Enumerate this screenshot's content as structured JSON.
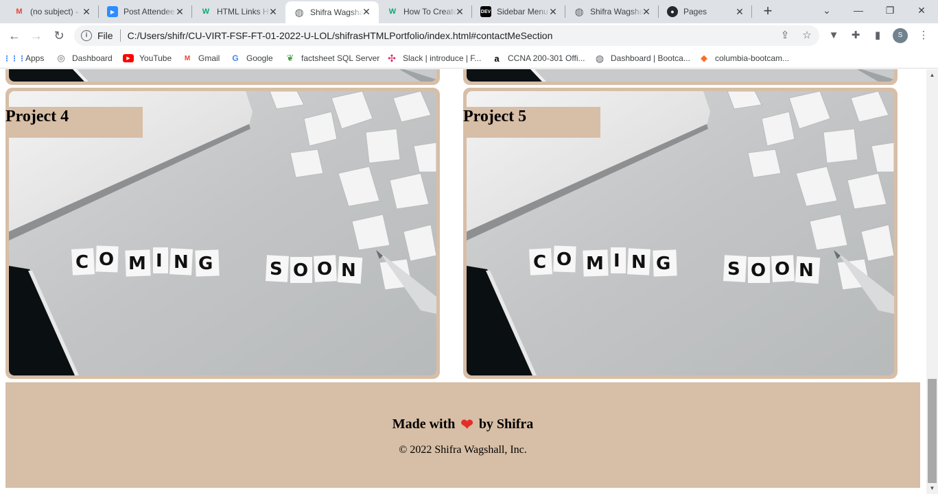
{
  "browser": {
    "tabs": [
      {
        "title": "(no subject) -",
        "favicon": "gmail-icon",
        "color": "#ea4335",
        "glyph": "M",
        "active": false
      },
      {
        "title": "Post Attendee",
        "favicon": "zoom-icon",
        "color": "#2d8cff",
        "glyph": "▶",
        "active": false
      },
      {
        "title": "HTML Links Hy",
        "favicon": "w3schools-icon",
        "color": "#04aa6d",
        "glyph": "W",
        "active": false
      },
      {
        "title": "Shifra Wagsha",
        "favicon": "globe-icon",
        "color": "#5f6368",
        "glyph": "◍",
        "active": true
      },
      {
        "title": "How To Create",
        "favicon": "w3schools-icon",
        "color": "#04aa6d",
        "glyph": "W",
        "active": false
      },
      {
        "title": "Sidebar Menu",
        "favicon": "dev-icon",
        "color": "#000000",
        "glyph": "DEV",
        "active": false
      },
      {
        "title": "Shifra Wagsha",
        "favicon": "globe-icon",
        "color": "#5f6368",
        "glyph": "◍",
        "active": false
      },
      {
        "title": "Pages",
        "favicon": "github-icon",
        "color": "#24292f",
        "glyph": "●",
        "active": false
      }
    ],
    "address": {
      "scheme_label": "File",
      "url": "C:/Users/shifr/CU-VIRT-FSF-FT-01-2022-U-LOL/shifrasHTMLPortfolio/index.html#contactMeSection"
    },
    "profile_initial": "S",
    "bookmarks": [
      {
        "label": "Apps",
        "icon": "apps-grid-icon",
        "color": "#4285f4",
        "glyph": "⋮⋮"
      },
      {
        "label": "Dashboard",
        "icon": "dashboard-icon",
        "color": "#5f6368",
        "glyph": "◎"
      },
      {
        "label": "YouTube",
        "icon": "youtube-icon",
        "color": "#ff0000",
        "glyph": "▶"
      },
      {
        "label": "Gmail",
        "icon": "gmail-icon",
        "color": "#ea4335",
        "glyph": "M"
      },
      {
        "label": "Google",
        "icon": "google-icon",
        "color": "#4285f4",
        "glyph": "G"
      },
      {
        "label": "factsheet SQL Server",
        "icon": "leaf-icon",
        "color": "#43a047",
        "glyph": "❦"
      },
      {
        "label": "Slack | introduce | F...",
        "icon": "slack-icon",
        "color": "#e01e5a",
        "glyph": "✣"
      },
      {
        "label": "CCNA 200-301 Offi...",
        "icon": "amazon-icon",
        "color": "#000000",
        "glyph": "a"
      },
      {
        "label": "Dashboard | Bootca...",
        "icon": "globe-icon",
        "color": "#5f6368",
        "glyph": "◍"
      },
      {
        "label": "columbia-bootcam...",
        "icon": "gitlab-icon",
        "color": "#fc6d26",
        "glyph": "◆"
      }
    ]
  },
  "page": {
    "projects": [
      {
        "label": "Project 4",
        "image_text": "COMING SOON"
      },
      {
        "label": "Project 5",
        "image_text": "COMING SOON"
      }
    ],
    "footer": {
      "made_with": "Made with",
      "heart": "❤",
      "by": "by Shifra",
      "copyright": "© 2022 Shifra Wagshall, Inc."
    }
  },
  "colors": {
    "accent_tan": "#d7bea6",
    "heart_red": "#e52d27"
  }
}
